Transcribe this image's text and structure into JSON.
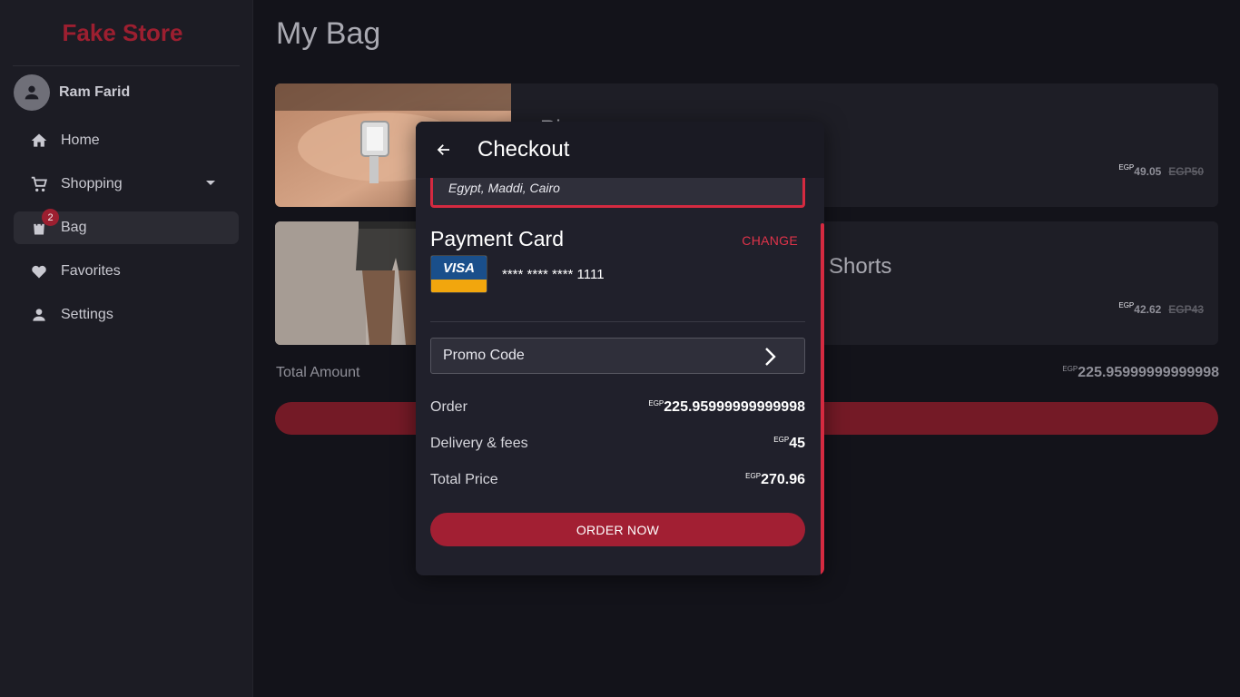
{
  "app": {
    "brand": "Fake Store"
  },
  "user": {
    "name": "Ram Farid"
  },
  "sidebar": {
    "items": [
      {
        "label": "Home",
        "icon": "home-icon"
      },
      {
        "label": "Shopping",
        "icon": "cart-icon"
      },
      {
        "label": "Bag",
        "icon": "bag-icon",
        "badge": "2"
      },
      {
        "label": "Favorites",
        "icon": "heart-icon"
      },
      {
        "label": "Settings",
        "icon": "person-icon"
      }
    ]
  },
  "main": {
    "title": "My Bag",
    "items": [
      {
        "name": "Ri",
        "currency": "EGP",
        "price": "49.05",
        "old_price": "EGP50"
      },
      {
        "name": "Shorts",
        "currency": "EGP",
        "price": "42.62",
        "old_price": "EGP43"
      }
    ],
    "total_label": "Total Amount",
    "total_currency": "EGP",
    "total_value": "225.95999999999998"
  },
  "checkout": {
    "title": "Checkout",
    "address": "Egypt, Maddi, Cairo",
    "payment_title": "Payment Card",
    "change_label": "CHANGE",
    "card_brand": "VISA",
    "card_number": "**** **** **** 1111",
    "promo_label": "Promo Code",
    "summary": [
      {
        "label": "Order",
        "currency": "EGP",
        "value": "225.95999999999998"
      },
      {
        "label": "Delivery & fees",
        "currency": "EGP",
        "value": "45"
      },
      {
        "label": "Total Price",
        "currency": "EGP",
        "value": "270.96"
      }
    ],
    "order_button": "ORDER NOW"
  },
  "colors": {
    "accent": "#a21f33",
    "accent_bright": "#d52a40",
    "brand": "#9c1f30",
    "background": "#13131a",
    "sidebar": "#1c1c24"
  }
}
